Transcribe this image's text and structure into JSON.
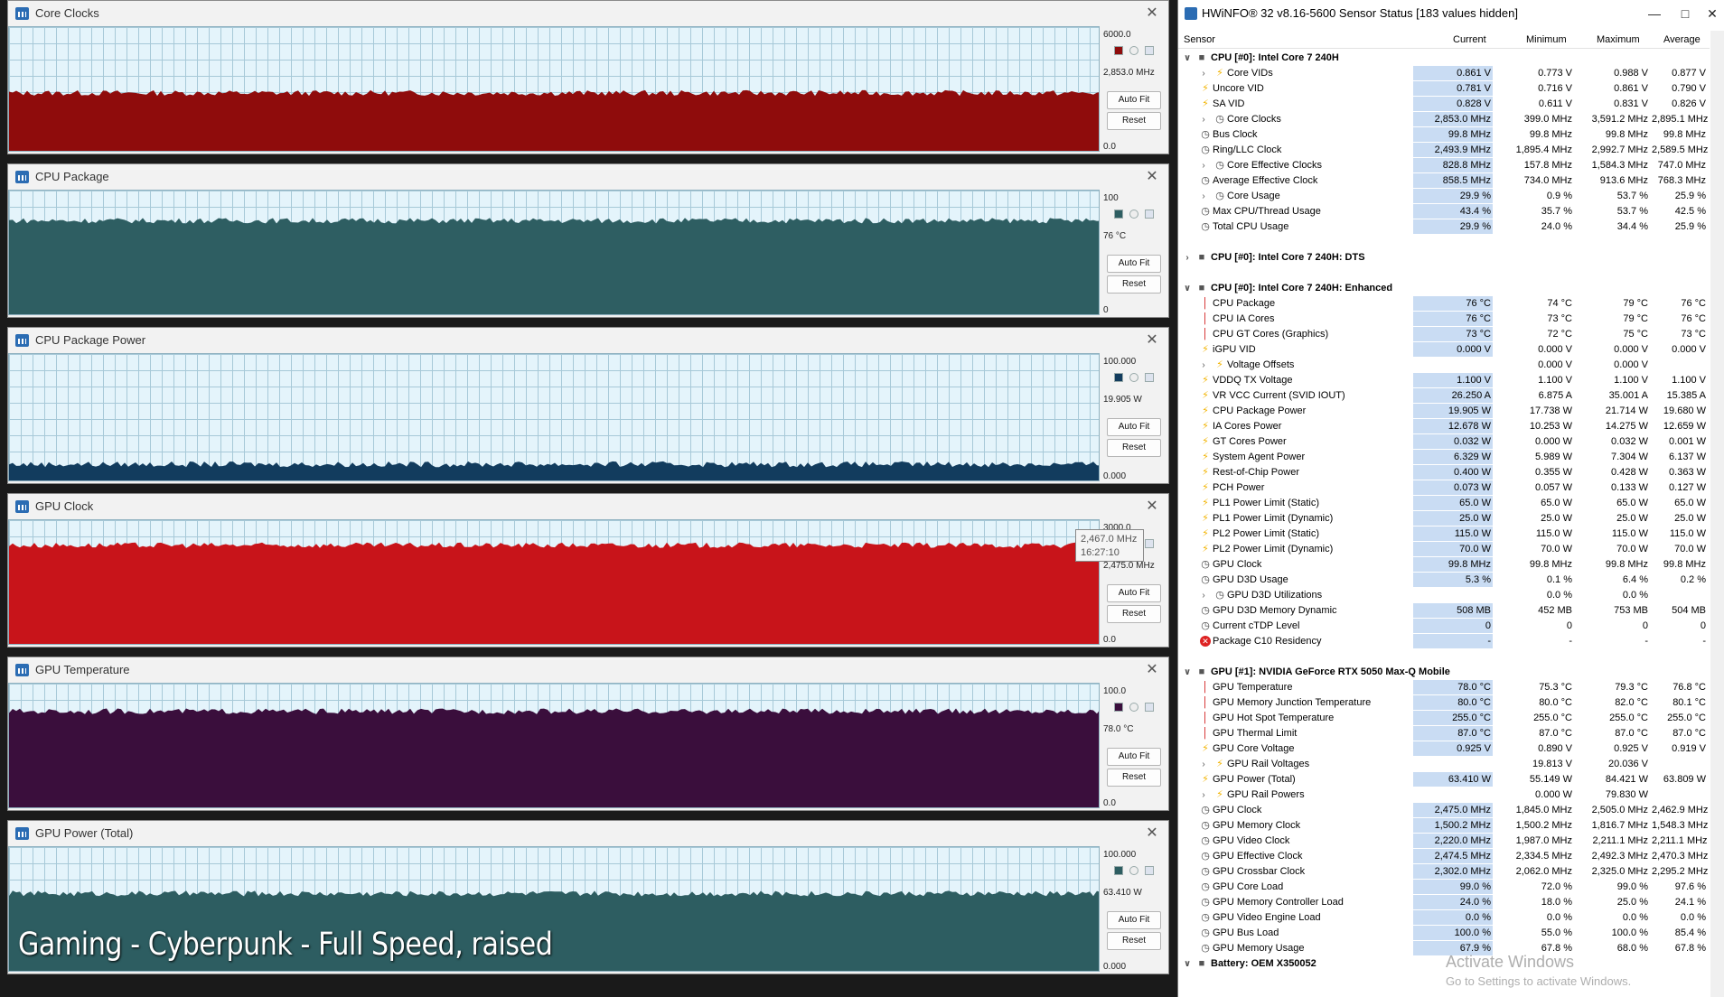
{
  "graphs": [
    {
      "title": "Core Clocks",
      "max": "6000.0",
      "current": "2,853.0 MHz",
      "min": "0.0",
      "color": "#8f0c0c",
      "auto_fit": "Auto Fit",
      "reset": "Reset",
      "level": 0.475
    },
    {
      "title": "CPU Package",
      "max": "100",
      "current": "76 °C",
      "min": "0",
      "color": "#2e5e62",
      "auto_fit": "Auto Fit",
      "reset": "Reset",
      "level": 0.76
    },
    {
      "title": "CPU Package Power",
      "max": "100.000",
      "current": "19.905 W",
      "min": "0.000",
      "color": "#123c5e",
      "auto_fit": "Auto Fit",
      "reset": "Reset",
      "level": 0.14
    },
    {
      "title": "GPU Clock",
      "max": "3000.0",
      "current": "2,475.0 MHz",
      "min": "0.0",
      "color": "#c8141a",
      "auto_fit": "Auto Fit",
      "reset": "Reset",
      "level": 0.8
    },
    {
      "title": "GPU Temperature",
      "max": "100.0",
      "current": "78.0 °C",
      "min": "0.0",
      "color": "#3a0e3c",
      "auto_fit": "Auto Fit",
      "reset": "Reset",
      "level": 0.78
    },
    {
      "title": "GPU Power (Total)",
      "max": "100.000",
      "current": "63.410 W",
      "min": "0.000",
      "color": "#2d5d61",
      "auto_fit": "Auto Fit",
      "reset": "Reset",
      "level": 0.63
    }
  ],
  "tooltip": {
    "value": "2,467.0 MHz",
    "time": "16:27:10"
  },
  "overlay_text": "Gaming - Cyberpunk - Full Speed, raised",
  "hwinfo": {
    "title": "HWiNFO® 32 v8.16-5600 Sensor Status [183 values hidden]",
    "headers": {
      "sensor": "Sensor",
      "current": "Current",
      "minimum": "Minimum",
      "maximum": "Maximum",
      "average": "Average"
    },
    "rows": [
      {
        "type": "group",
        "name": "CPU [#0]: Intel Core 7 240H",
        "exp": "v"
      },
      {
        "icon": "bolt",
        "name": "Core VIDs",
        "sub": true,
        "cur": "0.861 V",
        "min": "0.773 V",
        "max": "0.988 V",
        "avg": "0.877 V"
      },
      {
        "icon": "bolt",
        "name": "Uncore VID",
        "cur": "0.781 V",
        "min": "0.716 V",
        "max": "0.861 V",
        "avg": "0.790 V"
      },
      {
        "icon": "bolt",
        "name": "SA VID",
        "cur": "0.828 V",
        "min": "0.611 V",
        "max": "0.831 V",
        "avg": "0.826 V"
      },
      {
        "icon": "clock",
        "name": "Core Clocks",
        "sub": true,
        "cur": "2,853.0 MHz",
        "min": "399.0 MHz",
        "max": "3,591.2 MHz",
        "avg": "2,895.1 MHz"
      },
      {
        "icon": "clock",
        "name": "Bus Clock",
        "cur": "99.8 MHz",
        "min": "99.8 MHz",
        "max": "99.8 MHz",
        "avg": "99.8 MHz"
      },
      {
        "icon": "clock",
        "name": "Ring/LLC Clock",
        "cur": "2,493.9 MHz",
        "min": "1,895.4 MHz",
        "max": "2,992.7 MHz",
        "avg": "2,589.5 MHz"
      },
      {
        "icon": "clock",
        "name": "Core Effective Clocks",
        "sub": true,
        "cur": "828.8 MHz",
        "min": "157.8 MHz",
        "max": "1,584.3 MHz",
        "avg": "747.0 MHz"
      },
      {
        "icon": "clock",
        "name": "Average Effective Clock",
        "cur": "858.5 MHz",
        "min": "734.0 MHz",
        "max": "913.6 MHz",
        "avg": "768.3 MHz"
      },
      {
        "icon": "clock",
        "name": "Core Usage",
        "sub": true,
        "cur": "29.9 %",
        "min": "0.9 %",
        "max": "53.7 %",
        "avg": "25.9 %"
      },
      {
        "icon": "clock",
        "name": "Max CPU/Thread Usage",
        "cur": "43.4 %",
        "min": "35.7 %",
        "max": "53.7 %",
        "avg": "42.5 %"
      },
      {
        "icon": "clock",
        "name": "Total CPU Usage",
        "cur": "29.9 %",
        "min": "24.0 %",
        "max": "34.4 %",
        "avg": "25.9 %"
      },
      {
        "type": "gap"
      },
      {
        "type": "group",
        "name": "CPU [#0]: Intel Core 7 240H: DTS",
        "exp": ">"
      },
      {
        "type": "gap"
      },
      {
        "type": "group",
        "name": "CPU [#0]: Intel Core 7 240H: Enhanced",
        "exp": "v"
      },
      {
        "icon": "therm",
        "name": "CPU Package",
        "cur": "76 °C",
        "min": "74 °C",
        "max": "79 °C",
        "avg": "76 °C"
      },
      {
        "icon": "therm",
        "name": "CPU IA Cores",
        "cur": "76 °C",
        "min": "73 °C",
        "max": "79 °C",
        "avg": "76 °C"
      },
      {
        "icon": "therm",
        "name": "CPU GT Cores (Graphics)",
        "cur": "73 °C",
        "min": "72 °C",
        "max": "75 °C",
        "avg": "73 °C"
      },
      {
        "icon": "bolt",
        "name": "iGPU VID",
        "cur": "0.000 V",
        "min": "0.000 V",
        "max": "0.000 V",
        "avg": "0.000 V"
      },
      {
        "icon": "bolt",
        "name": "Voltage Offsets",
        "sub": true,
        "cur": "",
        "min": "0.000 V",
        "max": "0.000 V",
        "avg": ""
      },
      {
        "icon": "bolt",
        "name": "VDDQ TX Voltage",
        "cur": "1.100 V",
        "min": "1.100 V",
        "max": "1.100 V",
        "avg": "1.100 V"
      },
      {
        "icon": "bolt",
        "name": "VR VCC Current (SVID IOUT)",
        "cur": "26.250 A",
        "min": "6.875 A",
        "max": "35.001 A",
        "avg": "15.385 A"
      },
      {
        "icon": "bolt",
        "name": "CPU Package Power",
        "cur": "19.905 W",
        "min": "17.738 W",
        "max": "21.714 W",
        "avg": "19.680 W"
      },
      {
        "icon": "bolt",
        "name": "IA Cores Power",
        "cur": "12.678 W",
        "min": "10.253 W",
        "max": "14.275 W",
        "avg": "12.659 W"
      },
      {
        "icon": "bolt",
        "name": "GT Cores Power",
        "cur": "0.032 W",
        "min": "0.000 W",
        "max": "0.032 W",
        "avg": "0.001 W"
      },
      {
        "icon": "bolt",
        "name": "System Agent Power",
        "cur": "6.329 W",
        "min": "5.989 W",
        "max": "7.304 W",
        "avg": "6.137 W"
      },
      {
        "icon": "bolt",
        "name": "Rest-of-Chip Power",
        "cur": "0.400 W",
        "min": "0.355 W",
        "max": "0.428 W",
        "avg": "0.363 W"
      },
      {
        "icon": "bolt",
        "name": "PCH Power",
        "cur": "0.073 W",
        "min": "0.057 W",
        "max": "0.133 W",
        "avg": "0.127 W"
      },
      {
        "icon": "bolt",
        "name": "PL1 Power Limit (Static)",
        "cur": "65.0 W",
        "min": "65.0 W",
        "max": "65.0 W",
        "avg": "65.0 W"
      },
      {
        "icon": "bolt",
        "name": "PL1 Power Limit (Dynamic)",
        "cur": "25.0 W",
        "min": "25.0 W",
        "max": "25.0 W",
        "avg": "25.0 W"
      },
      {
        "icon": "bolt",
        "name": "PL2 Power Limit (Static)",
        "cur": "115.0 W",
        "min": "115.0 W",
        "max": "115.0 W",
        "avg": "115.0 W"
      },
      {
        "icon": "bolt",
        "name": "PL2 Power Limit (Dynamic)",
        "cur": "70.0 W",
        "min": "70.0 W",
        "max": "70.0 W",
        "avg": "70.0 W"
      },
      {
        "icon": "clock",
        "name": "GPU Clock",
        "cur": "99.8 MHz",
        "min": "99.8 MHz",
        "max": "99.8 MHz",
        "avg": "99.8 MHz"
      },
      {
        "icon": "clock",
        "name": "GPU D3D Usage",
        "cur": "5.3 %",
        "min": "0.1 %",
        "max": "6.4 %",
        "avg": "0.2 %"
      },
      {
        "icon": "clock",
        "name": "GPU D3D Utilizations",
        "sub": true,
        "cur": "",
        "min": "0.0 %",
        "max": "0.0 %",
        "avg": ""
      },
      {
        "icon": "clock",
        "name": "GPU D3D Memory Dynamic",
        "cur": "508 MB",
        "min": "452 MB",
        "max": "753 MB",
        "avg": "504 MB"
      },
      {
        "icon": "clock",
        "name": "Current cTDP Level",
        "cur": "0",
        "min": "0",
        "max": "0",
        "avg": "0"
      },
      {
        "icon": "x",
        "name": "Package C10 Residency",
        "cur": "-",
        "min": "-",
        "max": "-",
        "avg": "-"
      },
      {
        "type": "gap"
      },
      {
        "type": "group",
        "name": "GPU [#1]: NVIDIA  GeForce RTX 5050 Max-Q Mobile",
        "exp": "v"
      },
      {
        "icon": "therm",
        "name": "GPU Temperature",
        "cur": "78.0 °C",
        "min": "75.3 °C",
        "max": "79.3 °C",
        "avg": "76.8 °C"
      },
      {
        "icon": "therm",
        "name": "GPU Memory Junction Temperature",
        "cur": "80.0 °C",
        "min": "80.0 °C",
        "max": "82.0 °C",
        "avg": "80.1 °C"
      },
      {
        "icon": "therm",
        "name": "GPU Hot Spot Temperature",
        "cur": "255.0 °C",
        "min": "255.0 °C",
        "max": "255.0 °C",
        "avg": "255.0 °C"
      },
      {
        "icon": "therm",
        "name": "GPU Thermal Limit",
        "cur": "87.0 °C",
        "min": "87.0 °C",
        "max": "87.0 °C",
        "avg": "87.0 °C"
      },
      {
        "icon": "bolt",
        "name": "GPU Core Voltage",
        "cur": "0.925 V",
        "min": "0.890 V",
        "max": "0.925 V",
        "avg": "0.919 V"
      },
      {
        "icon": "bolt",
        "name": "GPU Rail Voltages",
        "sub": true,
        "cur": "",
        "min": "19.813 V",
        "max": "20.036 V",
        "avg": ""
      },
      {
        "icon": "bolt",
        "name": "GPU Power (Total)",
        "cur": "63.410 W",
        "min": "55.149 W",
        "max": "84.421 W",
        "avg": "63.809 W"
      },
      {
        "icon": "bolt",
        "name": "GPU Rail Powers",
        "sub": true,
        "cur": "",
        "min": "0.000 W",
        "max": "79.830 W",
        "avg": ""
      },
      {
        "icon": "clock",
        "name": "GPU Clock",
        "cur": "2,475.0 MHz",
        "min": "1,845.0 MHz",
        "max": "2,505.0 MHz",
        "avg": "2,462.9 MHz"
      },
      {
        "icon": "clock",
        "name": "GPU Memory Clock",
        "cur": "1,500.2 MHz",
        "min": "1,500.2 MHz",
        "max": "1,816.7 MHz",
        "avg": "1,548.3 MHz"
      },
      {
        "icon": "clock",
        "name": "GPU Video Clock",
        "cur": "2,220.0 MHz",
        "min": "1,987.0 MHz",
        "max": "2,211.1 MHz",
        "avg": "2,211.1 MHz"
      },
      {
        "icon": "clock",
        "name": "GPU Effective Clock",
        "cur": "2,474.5 MHz",
        "min": "2,334.5 MHz",
        "max": "2,492.3 MHz",
        "avg": "2,470.3 MHz"
      },
      {
        "icon": "clock",
        "name": "GPU Crossbar Clock",
        "cur": "2,302.0 MHz",
        "min": "2,062.0 MHz",
        "max": "2,325.0 MHz",
        "avg": "2,295.2 MHz"
      },
      {
        "icon": "clock",
        "name": "GPU Core Load",
        "cur": "99.0 %",
        "min": "72.0 %",
        "max": "99.0 %",
        "avg": "97.6 %"
      },
      {
        "icon": "clock",
        "name": "GPU Memory Controller Load",
        "cur": "24.0 %",
        "min": "18.0 %",
        "max": "25.0 %",
        "avg": "24.1 %"
      },
      {
        "icon": "clock",
        "name": "GPU Video Engine Load",
        "cur": "0.0 %",
        "min": "0.0 %",
        "max": "0.0 %",
        "avg": "0.0 %"
      },
      {
        "icon": "clock",
        "name": "GPU Bus Load",
        "cur": "100.0 %",
        "min": "55.0 %",
        "max": "100.0 %",
        "avg": "85.4 %"
      },
      {
        "icon": "clock",
        "name": "GPU Memory Usage",
        "cur": "67.9 %",
        "min": "67.8 %",
        "max": "68.0 %",
        "avg": "67.8 %"
      },
      {
        "type": "group",
        "name": "Battery: OEM X350052",
        "exp": "v"
      }
    ]
  },
  "watermark": {
    "line1": "Activate Windows",
    "line2": "Go to Settings to activate Windows."
  }
}
